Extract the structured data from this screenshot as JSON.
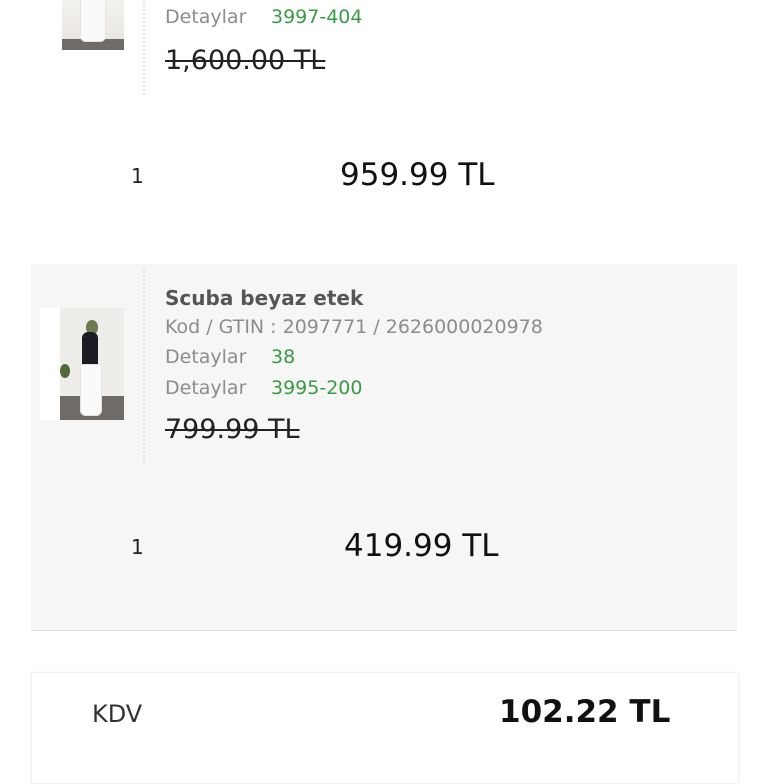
{
  "item1": {
    "detail_label": "Detaylar",
    "detail_value": "3997-404",
    "old_price": "1,600.00 TL",
    "quantity": "1",
    "price": "959.99 TL"
  },
  "item2": {
    "name": "Scuba beyaz etek",
    "code": "Kod / GTIN : 2097771 / 2626000020978",
    "details": [
      {
        "label": "Detaylar",
        "value": "38"
      },
      {
        "label": "Detaylar",
        "value": "3995-200"
      }
    ],
    "old_price": "799.99 TL",
    "quantity": "1",
    "price": "419.99 TL"
  },
  "summary": {
    "kdv_label": "KDV",
    "kdv_value": "102.22 TL"
  },
  "colors": {
    "accent_green": "#3a9a44",
    "muted_text": "#8c8c8c",
    "card_bg": "#f6f6f6"
  }
}
